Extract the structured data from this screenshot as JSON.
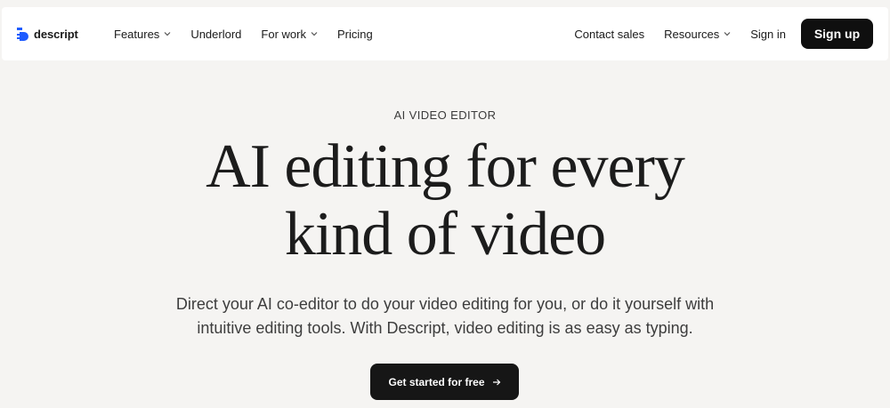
{
  "brand": {
    "name": "descript"
  },
  "nav": {
    "left": [
      {
        "label": "Features",
        "dropdown": true
      },
      {
        "label": "Underlord",
        "dropdown": false
      },
      {
        "label": "For work",
        "dropdown": true
      },
      {
        "label": "Pricing",
        "dropdown": false
      }
    ],
    "right": [
      {
        "label": "Contact sales",
        "dropdown": false
      },
      {
        "label": "Resources",
        "dropdown": true
      },
      {
        "label": "Sign in",
        "dropdown": false
      }
    ],
    "signup_label": "Sign up"
  },
  "hero": {
    "eyebrow": "AI VIDEO EDITOR",
    "headline_line1": "AI editing for every",
    "headline_line2": "kind of video",
    "subhead_line1": "Direct your AI co-editor to do your video editing for you, or do it yourself with",
    "subhead_line2": "intuitive editing tools. With Descript, video editing is as easy as typing.",
    "cta_label": "Get started for free"
  },
  "colors": {
    "background": "#f5f4f2",
    "nav_background": "#ffffff",
    "button_dark": "#0f0f0f",
    "brand_blue": "#1f5cff"
  },
  "icons": {
    "logo": "descript-logo-icon",
    "chevron": "chevron-down-icon",
    "cta_arrow": "arrow-right-icon"
  }
}
